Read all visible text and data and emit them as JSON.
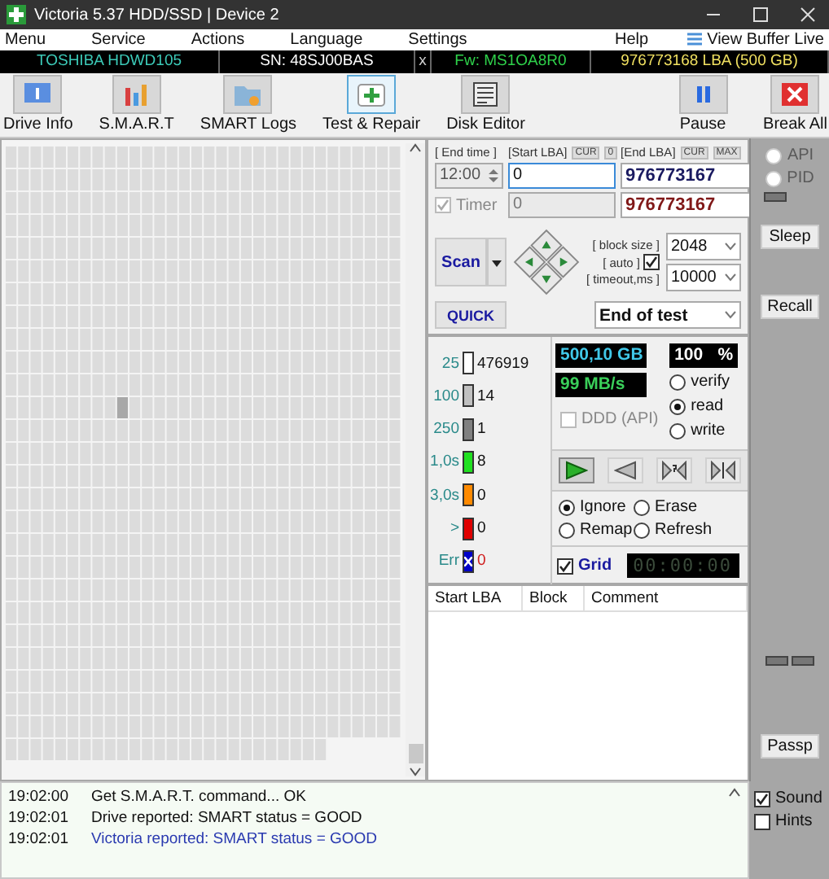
{
  "window": {
    "title": "Victoria 5.37 HDD/SSD | Device 2"
  },
  "menu": [
    "Menu",
    "Service",
    "Actions",
    "Language",
    "Settings"
  ],
  "menu_right": [
    "Help"
  ],
  "view_buffer": "View Buffer Live",
  "drive_bar": [
    {
      "kind": "model",
      "text": "TOSHIBA HDWD105"
    },
    {
      "kind": "serial",
      "text": "SN: 48SJ00BAS"
    },
    {
      "kind": "close",
      "text": "x"
    },
    {
      "kind": "firmware",
      "text": "Fw: MS1OA8R0"
    },
    {
      "kind": "capacity",
      "text": "976773168 LBA (500 GB)"
    }
  ],
  "toolbar": [
    {
      "kind": "info",
      "label": "Drive Info",
      "selected": false
    },
    {
      "kind": "smart",
      "label": "S.M.A.R.T",
      "selected": false
    },
    {
      "kind": "logs",
      "label": "SMART Logs",
      "selected": false
    },
    {
      "kind": "repair",
      "label": "Test & Repair",
      "selected": true
    },
    {
      "kind": "editor",
      "label": "Disk Editor",
      "selected": false
    }
  ],
  "toolbar_right": [
    {
      "kind": "pause",
      "label": "Pause"
    },
    {
      "kind": "stop",
      "label": "Break All"
    }
  ],
  "range": {
    "end_time": {
      "label": "[ End time ]",
      "value": "12:00"
    },
    "start_lba": {
      "label": "[Start LBA]",
      "badges": [
        "CUR",
        "0"
      ],
      "value": "0",
      "current": "0"
    },
    "end_lba": {
      "label": "[End LBA]",
      "badges": [
        "CUR",
        "MAX"
      ],
      "value": "976773167",
      "current": "976773167"
    },
    "timer": {
      "label": "Timer",
      "checked": true,
      "disabled": true
    }
  },
  "scan": {
    "button": "Scan",
    "quick": "QUICK",
    "block_size": {
      "label": "[ block size ]",
      "value": "2048"
    },
    "auto": {
      "label": "[ auto ]",
      "checked": true
    },
    "timeout": {
      "label": "[ timeout,ms ]",
      "value": "10000"
    },
    "end_action": "End of test"
  },
  "legend": [
    {
      "kind": "time",
      "label": "25",
      "count": "476919",
      "color": "#ffffff"
    },
    {
      "kind": "time",
      "label": "100",
      "count": "14",
      "color": "#c0c0c0"
    },
    {
      "kind": "time",
      "label": "250",
      "count": "1",
      "color": "#808080"
    },
    {
      "kind": "time",
      "label": "1,0s",
      "count": "8",
      "color": "#20e020"
    },
    {
      "kind": "time",
      "label": "3,0s",
      "count": "0",
      "color": "#ff8a00"
    },
    {
      "kind": "time",
      "label": ">",
      "count": "0",
      "color": "#e00000"
    },
    {
      "kind": "error",
      "label": "Err",
      "count": "0",
      "color": "#0000c8"
    }
  ],
  "stats": {
    "position": "500,10 GB",
    "percent": "100",
    "percent_unit": "%",
    "speed": "99 MB/s"
  },
  "mode": [
    {
      "label": "verify",
      "selected": false
    },
    {
      "label": "read",
      "selected": true
    },
    {
      "label": "write",
      "selected": false
    }
  ],
  "ddd": {
    "label": "DDD (API)",
    "checked": false,
    "disabled": true
  },
  "playback": [
    {
      "kind": "play",
      "selected": true
    },
    {
      "kind": "back",
      "selected": false
    },
    {
      "kind": "jump",
      "selected": false
    },
    {
      "kind": "end",
      "selected": false
    }
  ],
  "repair": [
    {
      "label": "Ignore",
      "selected": true
    },
    {
      "label": "Erase",
      "selected": false
    },
    {
      "label": "Remap",
      "selected": false
    },
    {
      "label": "Refresh",
      "selected": false
    }
  ],
  "grid": {
    "label": "Grid",
    "checked": true
  },
  "elapsed": "00:00:00",
  "table": {
    "columns": [
      "Start LBA",
      "Block",
      "Comment"
    ]
  },
  "side": {
    "radios": [
      {
        "label": "API",
        "selected": false,
        "disabled": true
      },
      {
        "label": "PID",
        "selected": false,
        "disabled": true
      }
    ],
    "buttons": [
      "Sleep",
      "Recall",
      "Passp"
    ]
  },
  "log": [
    {
      "time": "19:02:00",
      "message": "Get S.M.A.R.T. command... OK",
      "kind": "normal"
    },
    {
      "time": "19:02:01",
      "message": "Drive reported: SMART status = GOOD",
      "kind": "normal"
    },
    {
      "time": "19:02:01",
      "message": "Victoria reported: SMART status = GOOD",
      "kind": "highlight"
    }
  ],
  "options": [
    {
      "label": "Sound",
      "checked": true
    },
    {
      "label": "Hints",
      "checked": false
    }
  ]
}
